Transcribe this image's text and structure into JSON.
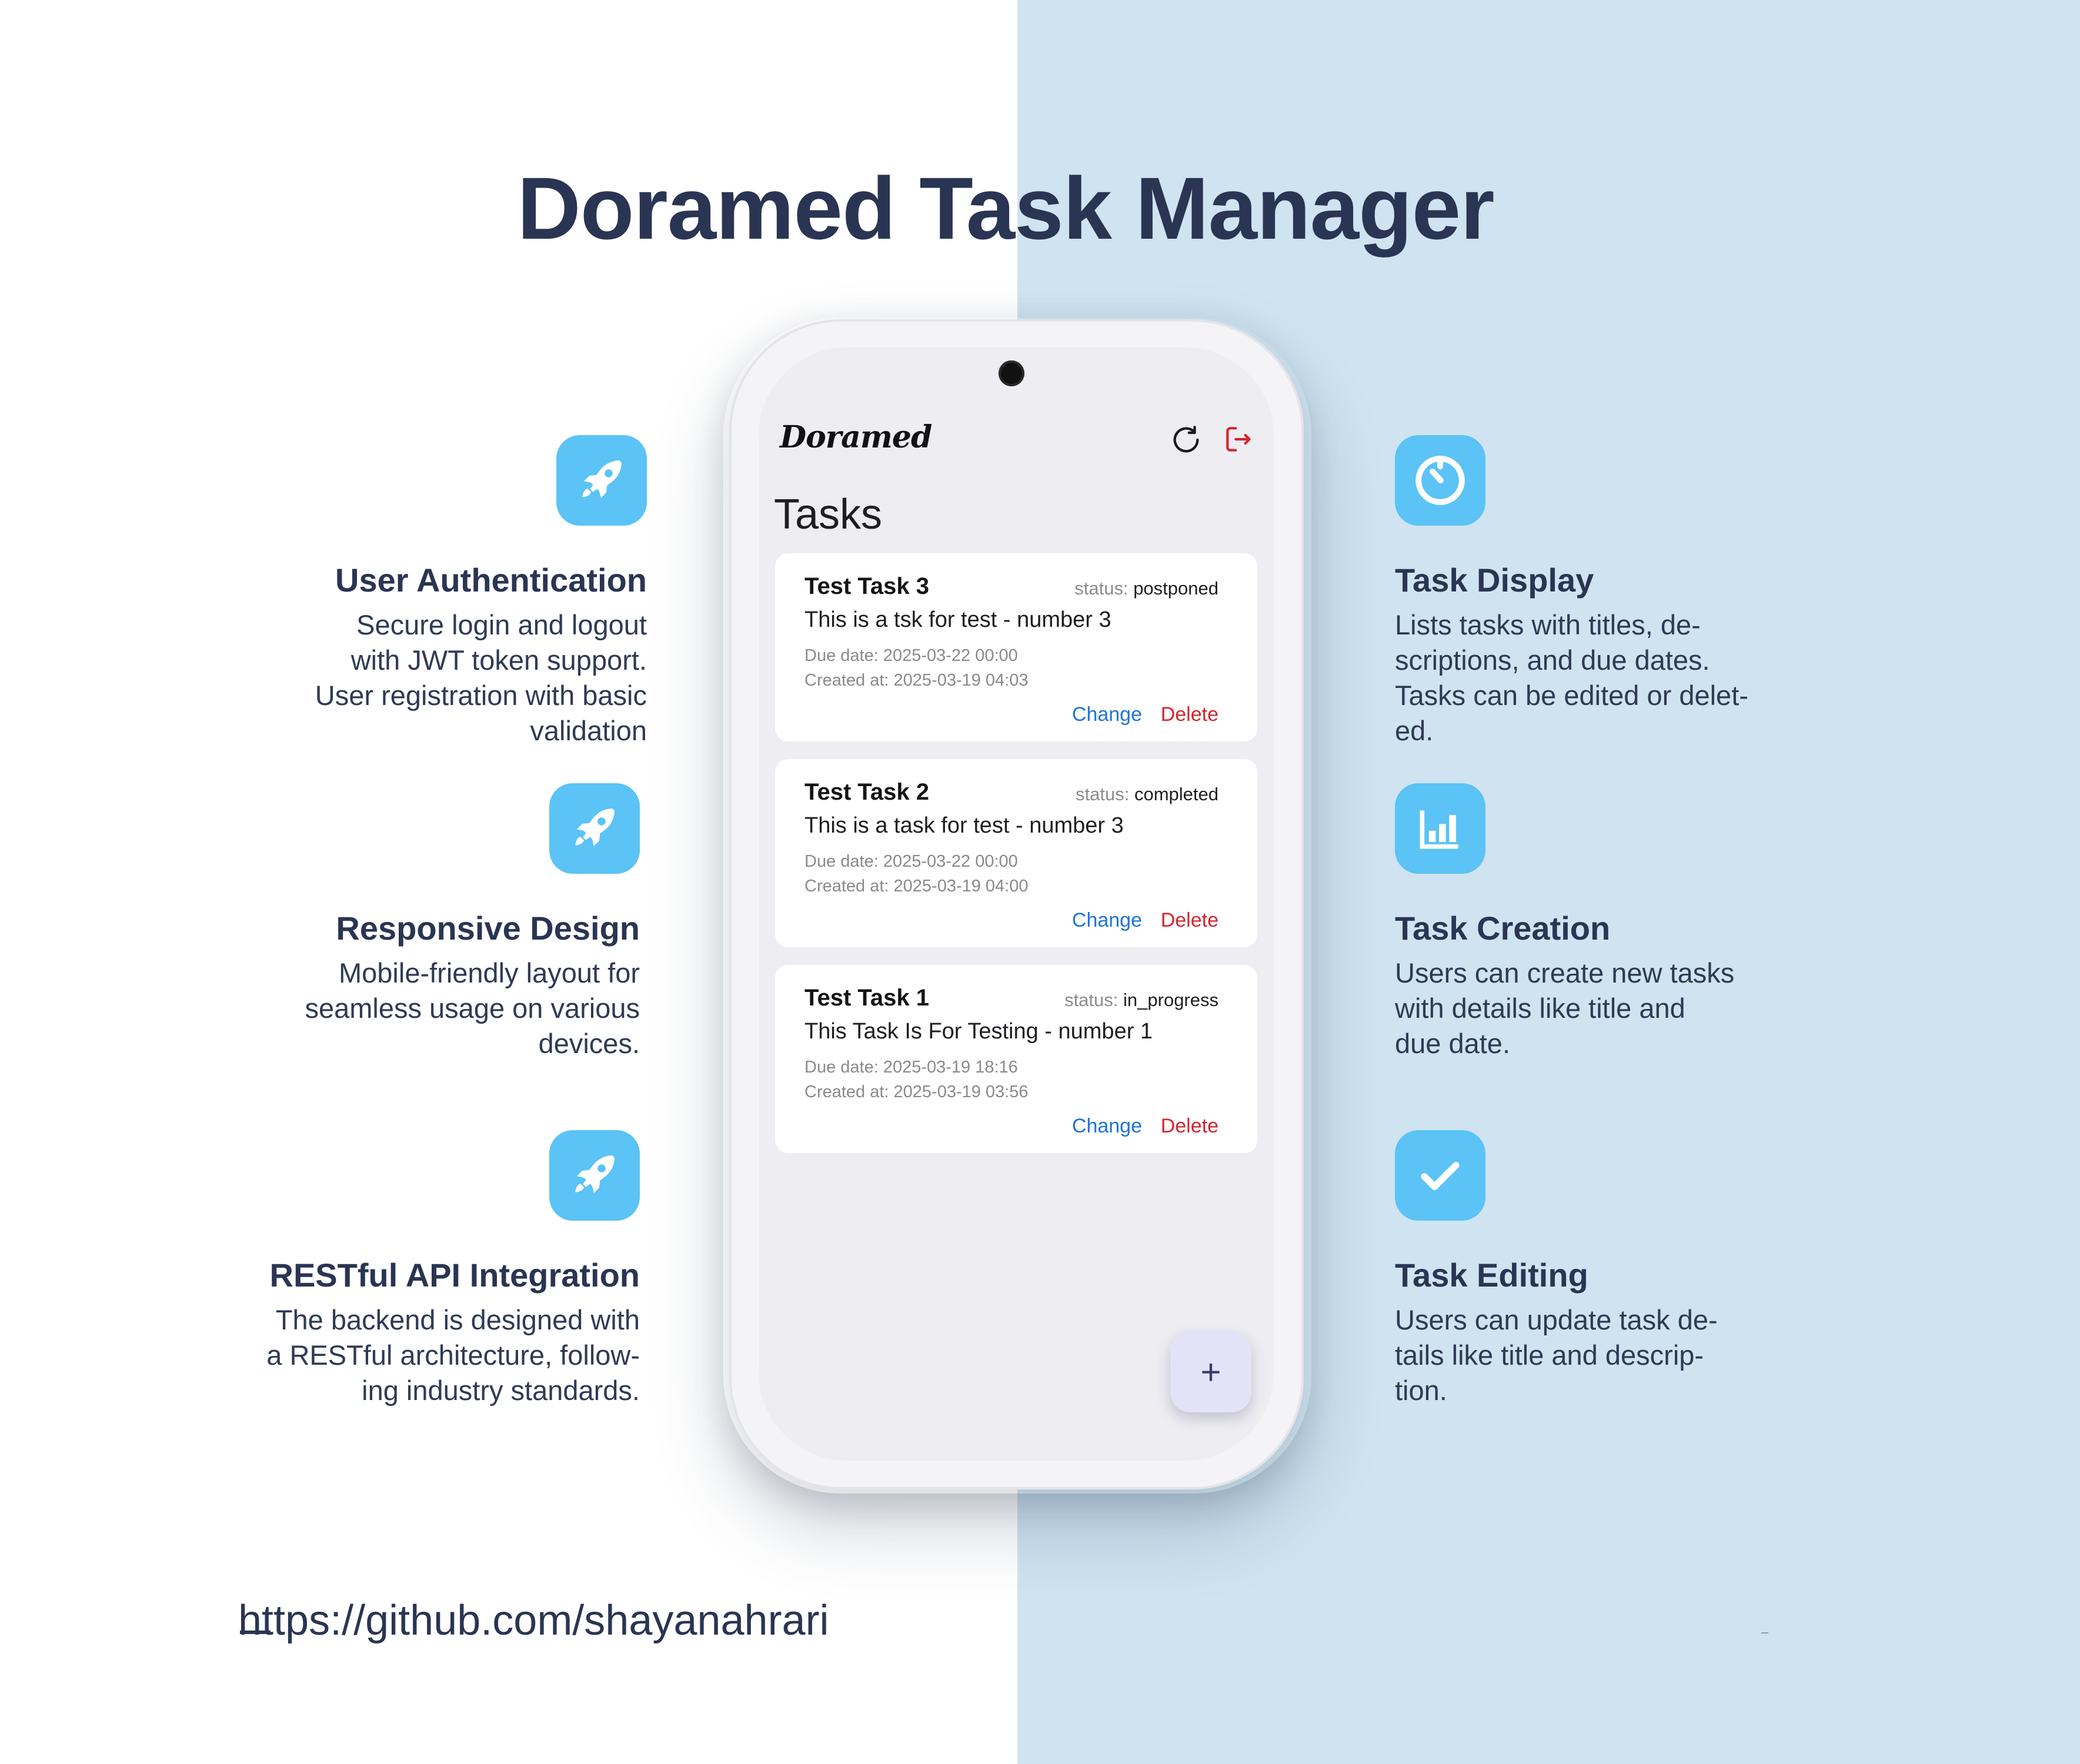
{
  "title": "Doramed Task Manager",
  "left_features": [
    {
      "icon": "rocket-icon",
      "title": "User Authentication",
      "lines": [
        "Secure login and logout",
        "with JWT token support.",
        "User registration with basic",
        "validation"
      ]
    },
    {
      "icon": "rocket-icon",
      "title": "Responsive Design",
      "lines": [
        "Mobile-friendly layout for",
        "seamless usage on various",
        "devices."
      ]
    },
    {
      "icon": "rocket-icon",
      "title": "RESTful API Integration",
      "lines": [
        "The backend is designed with",
        "a RESTful architecture, follow-",
        "ing industry standards."
      ]
    }
  ],
  "right_features": [
    {
      "icon": "timer-icon",
      "title": "Task Display",
      "lines": [
        "Lists tasks with titles, de-",
        "scriptions, and due dates.",
        "Tasks can be edited or delet-",
        "ed."
      ]
    },
    {
      "icon": "chart-icon",
      "title": "Task Creation",
      "lines": [
        "Users can create new tasks",
        "with details like title and",
        "due date."
      ]
    },
    {
      "icon": "check-icon",
      "title": "Task Editing",
      "lines": [
        "Users can update task de-",
        "tails like title and descrip-",
        "tion."
      ]
    }
  ],
  "footer": {
    "link": "https://github.com/shayanahrari"
  },
  "app": {
    "logo": "Doramed",
    "page_title": "Tasks",
    "status_prefix": "status:",
    "change_label": "Change",
    "delete_label": "Delete",
    "fab_label": "+",
    "tasks": [
      {
        "title": "Test Task 3",
        "status": "postponed",
        "description": "This is a tsk for test - number 3",
        "due": "Due date: 2025-03-22  00:00",
        "created": "Created at: 2025-03-19  04:03"
      },
      {
        "title": "Test Task 2",
        "status": "completed",
        "description": "This is a task for test - number 3",
        "due": "Due date: 2025-03-22  00:00",
        "created": "Created at: 2025-03-19  04:00"
      },
      {
        "title": "Test Task 1",
        "status": "in_progress",
        "description": "This Task Is For Testing - number 1",
        "due": "Due date: 2025-03-19  18:16",
        "created": "Created at: 2025-03-19  03:56"
      }
    ]
  },
  "colors": {
    "accent": "#5bc3f5",
    "right_bg": "#cfe3f0",
    "heading": "#2a3553",
    "change": "#1f74d6",
    "delete": "#d6232d"
  }
}
